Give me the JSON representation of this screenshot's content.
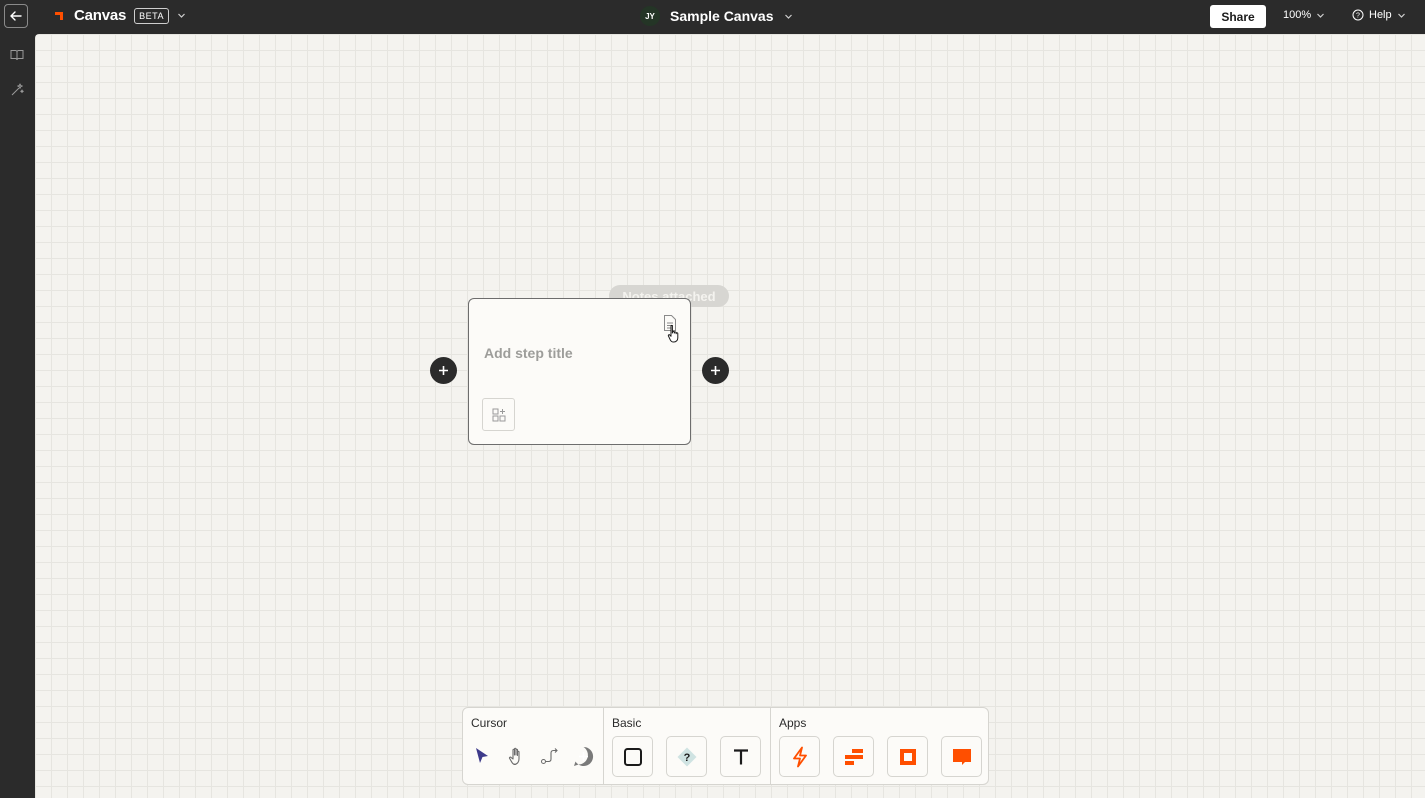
{
  "topbar": {
    "brand_name": "Canvas",
    "beta_label": "BETA",
    "avatar_initials": "JY",
    "canvas_title": "Sample Canvas",
    "share_label": "Share",
    "zoom_label": "100%",
    "help_label": "Help"
  },
  "sidebar": {
    "items": [
      {
        "icon": "book-icon"
      },
      {
        "icon": "magic-wand-icon"
      }
    ]
  },
  "canvas": {
    "tooltip_text": "Notes attached",
    "step_card": {
      "title_placeholder": "Add step title"
    }
  },
  "toolbar": {
    "sections": [
      {
        "label": "Cursor",
        "tools": [
          "select-arrow-icon",
          "hand-icon",
          "connector-path-icon",
          "add-comment-icon"
        ]
      },
      {
        "label": "Basic",
        "tools": [
          "square-icon",
          "decision-diamond-icon",
          "text-icon"
        ]
      },
      {
        "label": "Apps",
        "tools": [
          "zap-icon",
          "tables-icon",
          "interfaces-icon",
          "chatbot-icon"
        ]
      }
    ]
  },
  "colors": {
    "brand_orange": "#ff4f00",
    "topbar_bg": "#2b2b2b",
    "canvas_bg": "#f4f3ef",
    "select_accent": "#3d3a8a"
  }
}
